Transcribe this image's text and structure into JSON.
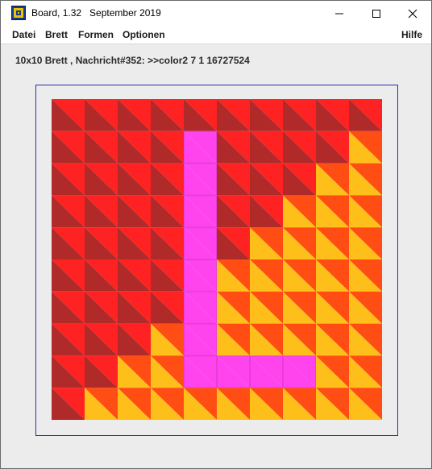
{
  "window": {
    "title": "Board, 1.32   September 2019",
    "icon": "board-app-icon"
  },
  "controls": {
    "minimize_icon": "minimize-icon",
    "maximize_icon": "maximize-icon",
    "close_icon": "close-icon"
  },
  "menu": {
    "items": [
      "Datei",
      "Brett",
      "Formen",
      "Optionen"
    ],
    "help": "Hilfe"
  },
  "status": {
    "text": "10x10 Brett , Nachricht#352: >>color2 7 1 16727524"
  },
  "board": {
    "rows": 10,
    "cols": 10,
    "colors": {
      "R": [
        "#ff2222",
        "#b02a2a"
      ],
      "Y": [
        "#ff4d14",
        "#ffbf1a"
      ],
      "P": [
        "#ff44ee",
        "#ff44ee"
      ]
    },
    "grid": [
      "RRRRRRRRRR",
      "RRRRPRRRRY",
      "RRRRPRRRYY",
      "RRRRPRRYYY",
      "RRRRPRYYYY",
      "RRRRPYYYYY",
      "RRRRPYYYYY",
      "RRRYPYYYYY",
      "RRYYPPPPYY",
      "RYYYYYYYYY"
    ]
  }
}
